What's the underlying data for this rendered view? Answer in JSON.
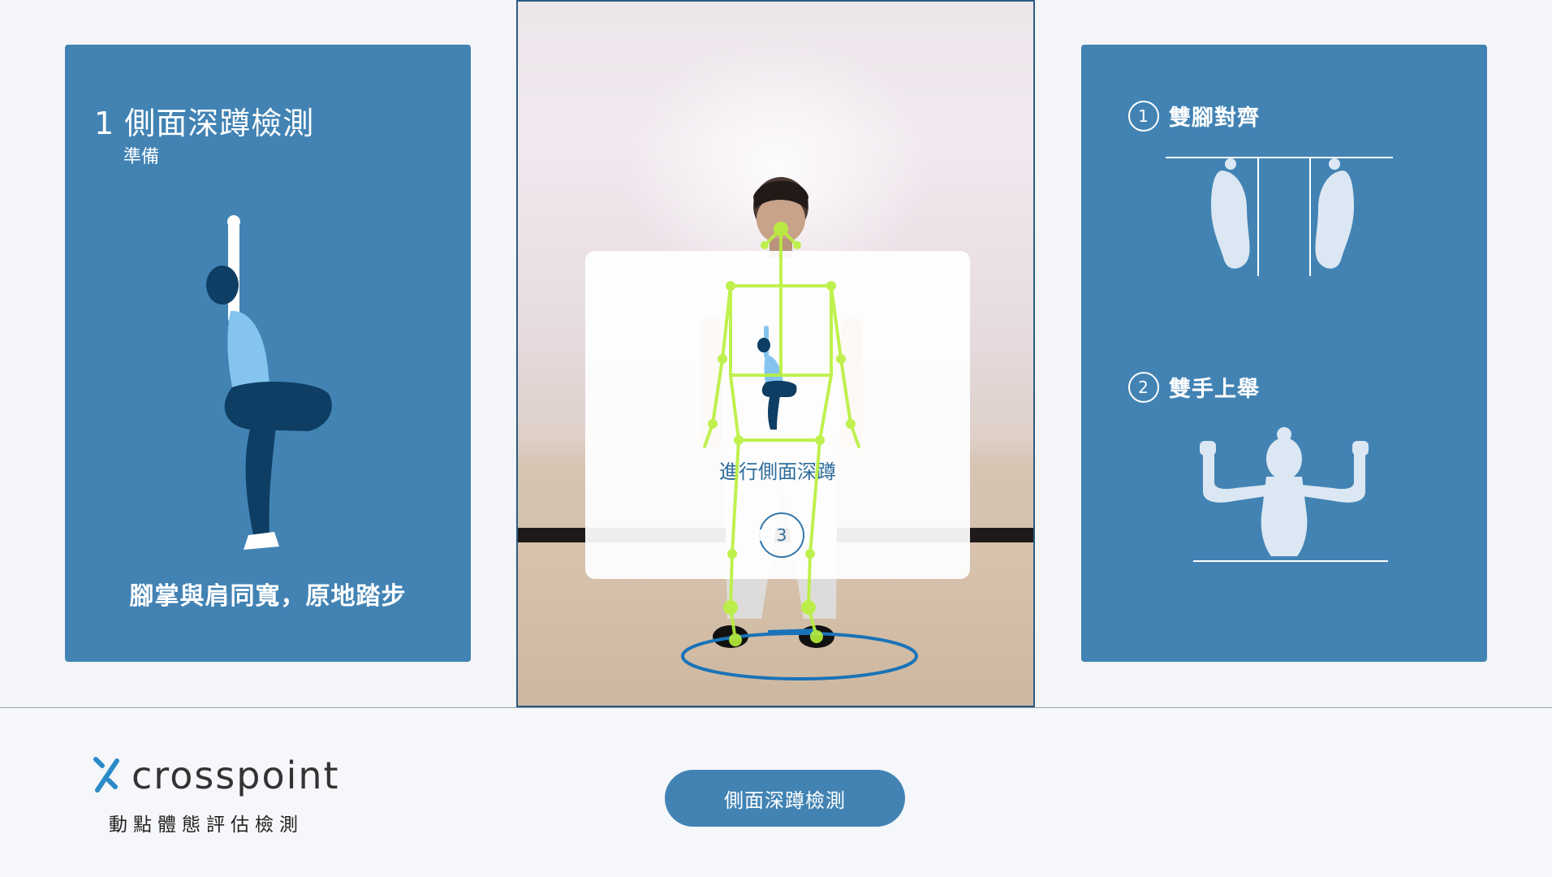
{
  "left_panel": {
    "step_number": "1",
    "title": "側面深蹲檢測",
    "subtitle": "準備",
    "instruction": "腳掌與肩同寬，原地踏步"
  },
  "camera": {
    "overlay_text": "進行側面深蹲",
    "countdown": "3"
  },
  "right_panel": {
    "tips": [
      {
        "number": "1",
        "label": "雙腳對齊"
      },
      {
        "number": "2",
        "label": "雙手上舉"
      }
    ]
  },
  "footer": {
    "logo_text": "crosspoint",
    "tagline": "動點體態評估檢測",
    "button_label": "側面深蹲檢測"
  },
  "colors": {
    "panel_blue": "#4283b4",
    "skeleton_green": "#b9f03c",
    "floor_circle": "#1a73b8"
  }
}
